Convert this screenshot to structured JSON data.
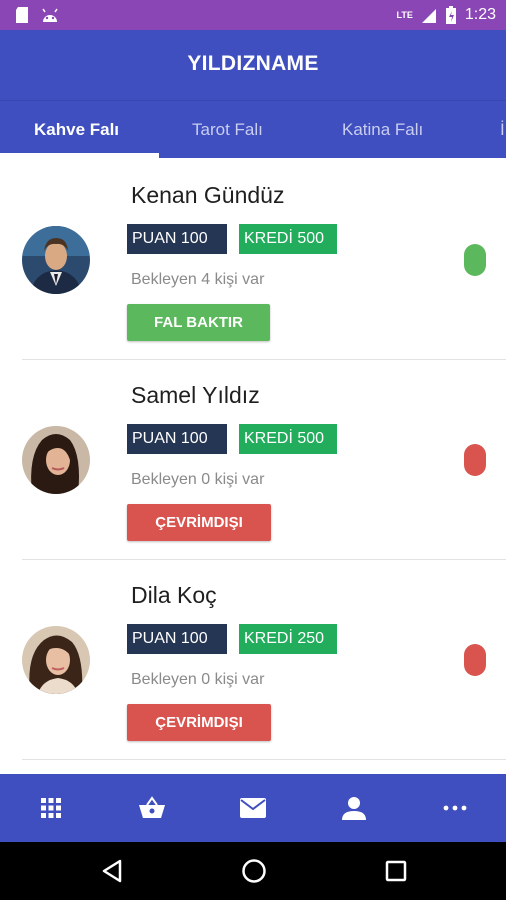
{
  "status_bar": {
    "network": "LTE",
    "time": "1:23"
  },
  "app_bar": {
    "title": "YILDIZNAME"
  },
  "tabs": [
    {
      "label": "Kahve Falı",
      "active": true
    },
    {
      "label": "Tarot Falı",
      "active": false
    },
    {
      "label": "Katina Falı",
      "active": false
    },
    {
      "label": "İ",
      "active": false
    }
  ],
  "fortune_tellers": [
    {
      "name": "Kenan Gündüz",
      "puan": "PUAN 100",
      "kredi": "KREDİ 500",
      "waiting": "Bekleyen 4 kişi var",
      "action_label": "FAL BAKTIR",
      "online": true
    },
    {
      "name": "Samel Yıldız",
      "puan": "PUAN 100",
      "kredi": "KREDİ 500",
      "waiting": "Bekleyen 0 kişi var",
      "action_label": "ÇEVRİMDIŞI",
      "online": false
    },
    {
      "name": "Dila Koç",
      "puan": "PUAN 100",
      "kredi": "KREDİ 250",
      "waiting": "Bekleyen 0 kişi var",
      "action_label": "ÇEVRİMDIŞI",
      "online": false
    }
  ],
  "bottom_nav": [
    "apps-grid-icon",
    "shopping-basket-icon",
    "mail-icon",
    "person-icon",
    "more-dots-icon"
  ],
  "colors": {
    "status_bar": "#8a46b5",
    "primary": "#3f4fbf",
    "puan_badge": "#243654",
    "kredi_badge": "#22ad5c",
    "online": "#5cb85c",
    "offline": "#d9534f"
  }
}
